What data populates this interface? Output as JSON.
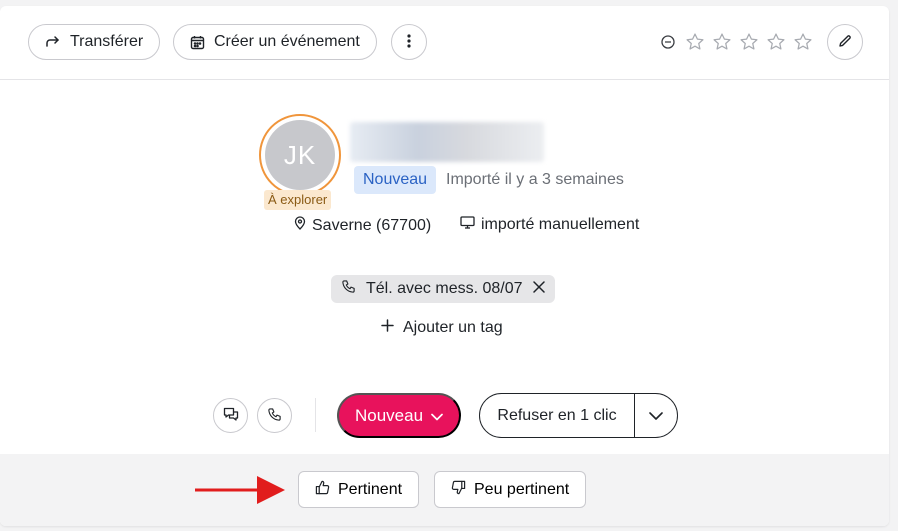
{
  "toolbar": {
    "transfer_label": "Transférer",
    "create_event_label": "Créer un événement",
    "rating": {
      "value": 0,
      "max": 5
    }
  },
  "contact": {
    "initials": "JK",
    "explore_badge": "À explorer",
    "status_chip": "Nouveau",
    "imported_ago": "Importé il y a 3 semaines",
    "location": "Saverne (67700)",
    "source": "importé manuellement"
  },
  "tags": {
    "items": [
      {
        "label": "Tél. avec mess. 08/07"
      }
    ],
    "add_label": "Ajouter un tag"
  },
  "actions": {
    "status_label": "Nouveau",
    "refuse_label": "Refuser en 1 clic"
  },
  "feedback": {
    "relevant_label": "Pertinent",
    "not_relevant_label": "Peu pertinent"
  },
  "colors": {
    "accent": "#e8125c",
    "avatar_ring": "#f0953b",
    "status_chip_bg": "#dbe8fb",
    "status_chip_text": "#2a62c4",
    "explore_badge_bg": "#fbe8cf",
    "annotation_arrow": "#e11d1d"
  }
}
